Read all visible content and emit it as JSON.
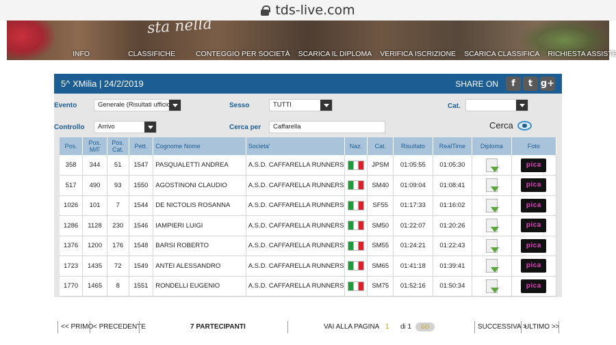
{
  "browser": {
    "url": "tds-live.com"
  },
  "banner": {
    "slogan": "sta nella"
  },
  "nav": {
    "items": [
      "INFO",
      "CLASSIFICHE",
      "CONTEGGIO PER SOCIETÀ",
      "SCARICA IL DIPLOMA",
      "VERIFICA ISCRIZIONE",
      "SCARICA CLASSIFICA",
      "RICHIESTA ASSISTENZA"
    ]
  },
  "event": {
    "title": "5^ XMilia  |  24/2/2019"
  },
  "share": {
    "label": "SHARE ON",
    "icons": [
      "facebook-icon",
      "twitter-icon",
      "googleplus-icon"
    ],
    "glyphs": [
      "f",
      "t",
      "g+"
    ]
  },
  "filters": {
    "evento_label": "Evento",
    "evento_value": "Generale (Risultati ufficiosi)",
    "sesso_label": "Sesso",
    "sesso_value": "TUTTI",
    "cat_label": "Cat.",
    "cat_value": "",
    "controllo_label": "Controllo",
    "controllo_value": "Arrivo",
    "cerca_per_label": "Cerca per",
    "cerca_per_value": "Caffarella",
    "cerca_button": "Cerca"
  },
  "table": {
    "headers": {
      "pos": "Pos.",
      "pos_mf": "Pos. M/F",
      "pos_cat": "Pos. Cat.",
      "pett": "Pett.",
      "nome": "Cognome Nome",
      "societa": "Societa'",
      "naz": "Naz.",
      "cat": "Cat.",
      "risultato": "Risultato",
      "realtime": "RealTime",
      "diploma": "Diploma",
      "foto": "Foto"
    },
    "rows": [
      {
        "pos": "358",
        "pos_mf": "344",
        "pos_cat": "51",
        "pett": "1547",
        "nome": "PASQUALETTI ANDREA",
        "societa": "A.S.D. CAFFARELLA RUNNERS",
        "cat": "JPSM",
        "risultato": "01:05:55",
        "realtime": "01:05:30"
      },
      {
        "pos": "517",
        "pos_mf": "490",
        "pos_cat": "93",
        "pett": "1550",
        "nome": "AGOSTINONI CLAUDIO",
        "societa": "A.S.D. CAFFARELLA RUNNERS",
        "cat": "SM40",
        "risultato": "01:09:04",
        "realtime": "01:08:41"
      },
      {
        "pos": "1026",
        "pos_mf": "101",
        "pos_cat": "7",
        "pett": "1544",
        "nome": "DE NICTOLIS ROSANNA",
        "societa": "A.S.D. CAFFARELLA RUNNERS",
        "cat": "SF55",
        "risultato": "01:17:33",
        "realtime": "01:16:02"
      },
      {
        "pos": "1286",
        "pos_mf": "1128",
        "pos_cat": "230",
        "pett": "1546",
        "nome": "IAMPIERI LUIGI",
        "societa": "A.S.D. CAFFARELLA RUNNERS",
        "cat": "SM50",
        "risultato": "01:22:07",
        "realtime": "01:20:26"
      },
      {
        "pos": "1376",
        "pos_mf": "1200",
        "pos_cat": "176",
        "pett": "1548",
        "nome": "BARSI ROBERTO",
        "societa": "A.S.D. CAFFARELLA RUNNERS",
        "cat": "SM55",
        "risultato": "01:24:21",
        "realtime": "01:22:43"
      },
      {
        "pos": "1723",
        "pos_mf": "1435",
        "pos_cat": "72",
        "pett": "1549",
        "nome": "ANTEI ALESSANDRO",
        "societa": "A.S.D. CAFFARELLA RUNNERS",
        "cat": "SM65",
        "risultato": "01:41:18",
        "realtime": "01:39:41"
      },
      {
        "pos": "1770",
        "pos_mf": "1465",
        "pos_cat": "8",
        "pett": "1551",
        "nome": "RONDELLI EUGENIO",
        "societa": "A.S.D. CAFFARELLA RUNNERS",
        "cat": "SM75",
        "risultato": "01:52:16",
        "realtime": "01:50:34"
      }
    ],
    "foto_label": "pica"
  },
  "pager": {
    "primo": "<< PRIMO",
    "precedente": "< PRECEDENTE",
    "partecipanti": "7 PARTECIPANTI",
    "vai_alla_pagina": "VAI ALLA PAGINA",
    "page": "1",
    "di": "di 1",
    "go": "GO",
    "successiva": "SUCCESSIVA >",
    "ultimo": "ULTIMO >>"
  },
  "colors": {
    "header_blue": "#1c5d94",
    "table_header": "#a9c3db",
    "panel_bg": "#e6e6e6"
  }
}
